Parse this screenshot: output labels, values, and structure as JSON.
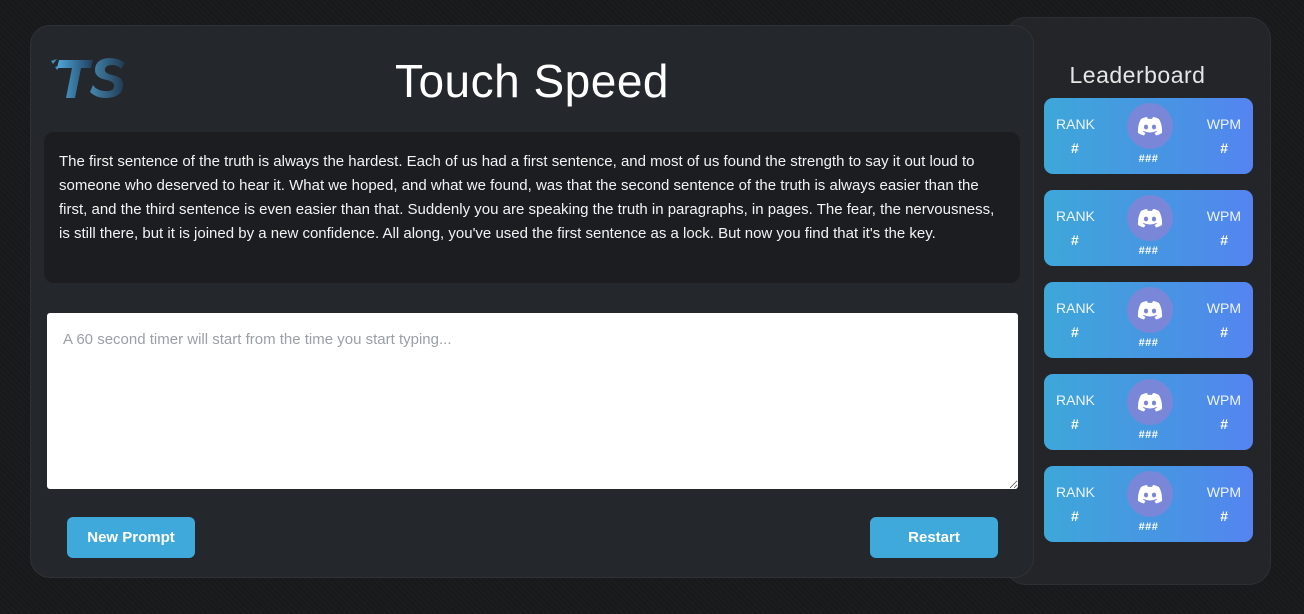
{
  "app": {
    "title": "Touch Speed",
    "logo_text": "TS"
  },
  "prompt": {
    "text": "The first sentence of the truth is always the hardest. Each of us had a first sentence, and most of us found the strength to say it out loud to someone who deserved to hear it. What we hoped, and what we found, was that the second sentence of the truth is always easier than the first, and the third sentence is even easier than that. Suddenly you are speaking the truth in paragraphs, in pages. The fear, the nervousness, is still there, but it is joined by a new confidence. All along, you've used the first sentence as a lock. But now you find that it's the key."
  },
  "typing": {
    "placeholder": "A 60 second timer will start from the time you start typing...",
    "value": ""
  },
  "buttons": {
    "new_prompt": "New Prompt",
    "restart": "Restart"
  },
  "leaderboard": {
    "title": "Leaderboard",
    "entries": [
      {
        "rank_label": "RANK",
        "rank": "#",
        "wpm_label": "WPM",
        "wpm": "#",
        "name": "###",
        "avatar_icon": "discord-icon"
      },
      {
        "rank_label": "RANK",
        "rank": "#",
        "wpm_label": "WPM",
        "wpm": "#",
        "name": "###",
        "avatar_icon": "discord-icon"
      },
      {
        "rank_label": "RANK",
        "rank": "#",
        "wpm_label": "WPM",
        "wpm": "#",
        "name": "###",
        "avatar_icon": "discord-icon"
      },
      {
        "rank_label": "RANK",
        "rank": "#",
        "wpm_label": "WPM",
        "wpm": "#",
        "name": "###",
        "avatar_icon": "discord-icon"
      },
      {
        "rank_label": "RANK",
        "rank": "#",
        "wpm_label": "WPM",
        "wpm": "#",
        "name": "###",
        "avatar_icon": "discord-icon"
      }
    ]
  },
  "colors": {
    "accent": "#3fa9dc",
    "card_gradient_start": "#3ea7d9",
    "card_gradient_end": "#5584f2",
    "avatar": "#7a87d8",
    "background": "#18191b",
    "panel": "#24272b"
  }
}
